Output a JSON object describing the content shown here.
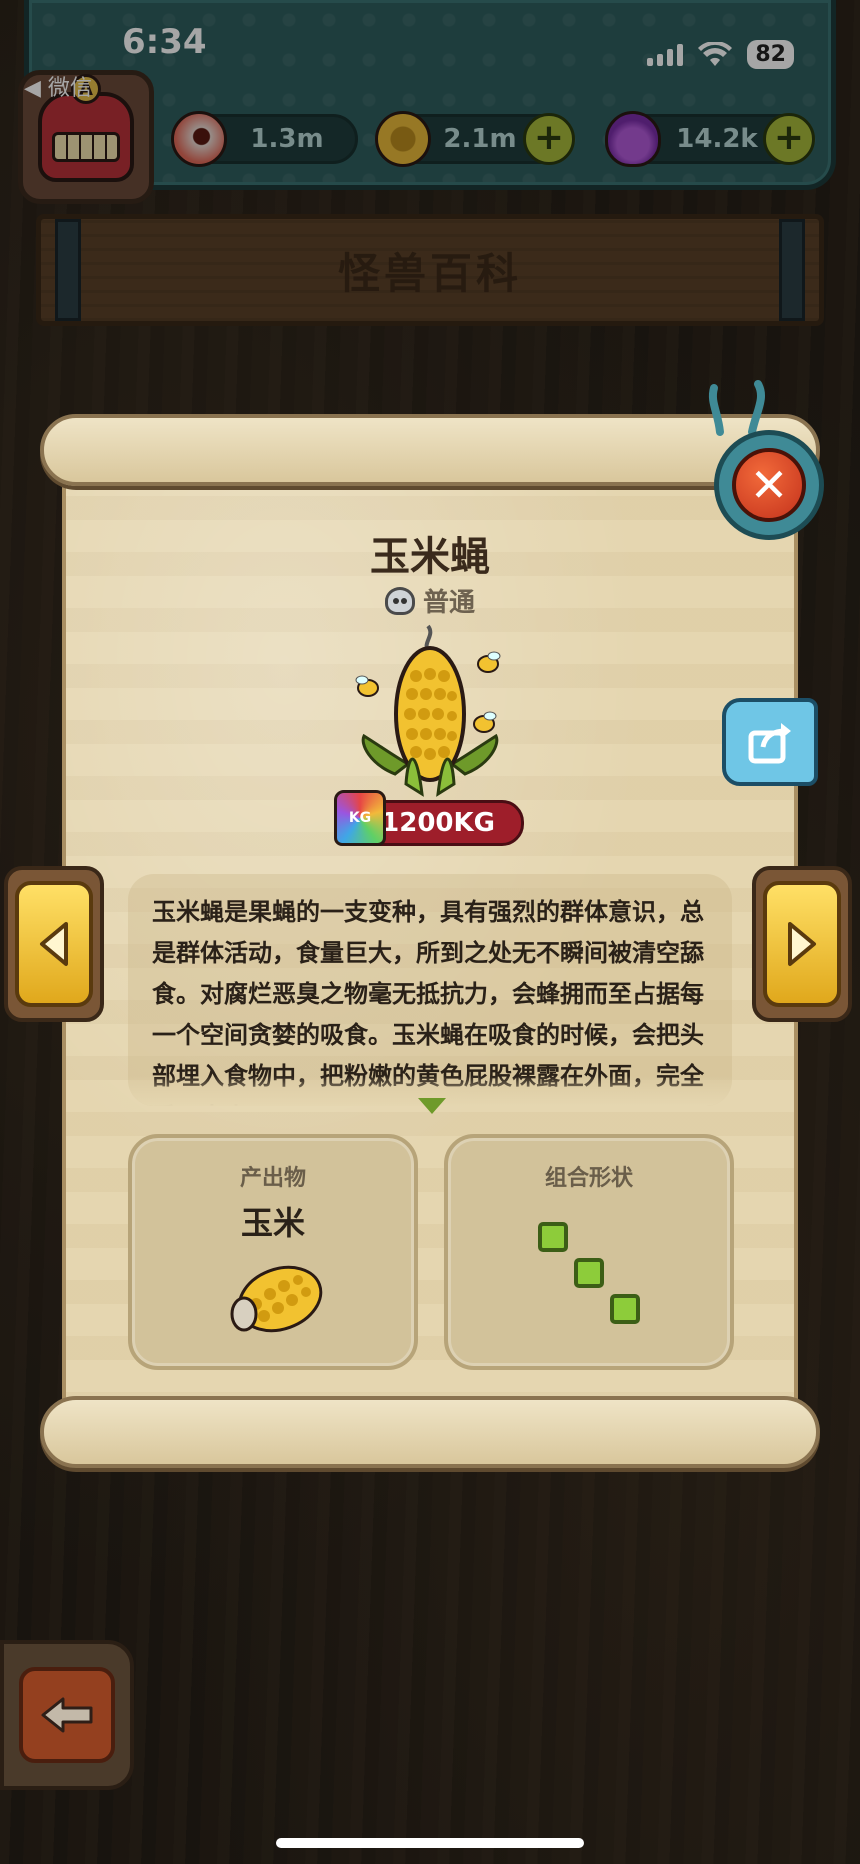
{
  "status_bar": {
    "time": "6:34",
    "back_app": "◀ 微信",
    "battery": "82"
  },
  "hud": {
    "resources": [
      {
        "icon": "eyeball-icon",
        "value": "1.3m",
        "has_plus": false
      },
      {
        "icon": "coin-icon",
        "value": "2.1m",
        "has_plus": true
      },
      {
        "icon": "potion-icon",
        "value": "14.2k",
        "has_plus": true
      }
    ]
  },
  "page": {
    "title": "怪兽百科"
  },
  "monster": {
    "name": "玉米蝇",
    "rarity": "普通",
    "weight": "1200KG",
    "weight_icon_label": "KG",
    "description": "玉米蝇是果蝇的一支变种，具有强烈的群体意识，总是群体活动，食量巨大，所到之处无不瞬间被清空舔食。对腐烂恶臭之物毫无抵抗力，会蜂拥而至占据每一个空间贪婪的吸食。玉米蝇在吸食的时候，会把头部埋入食物中，把粉嫩的黄色屁股裸露在外面，完全看不出来"
  },
  "product_card": {
    "title": "产出物",
    "value": "玉米"
  },
  "shape_card": {
    "title": "组合形状",
    "cells": 3
  },
  "colors": {
    "hud_teal": "#2f5f5f",
    "paper": "#e5d6b0",
    "weight_red": "#9e1e2a",
    "shape_green": "#8dcc3a",
    "nav_yellow": "#ffe066"
  }
}
